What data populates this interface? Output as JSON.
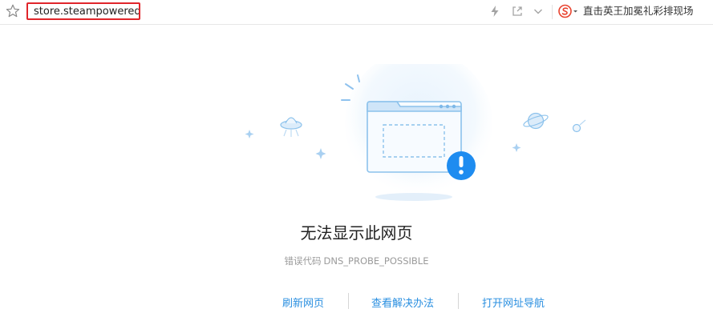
{
  "address_bar": {
    "url": "store.steampowered"
  },
  "toolbar": {
    "promo_text": "直击英王加冕礼彩排现场"
  },
  "error_page": {
    "title": "无法显示此网页",
    "code_label": "错误代码",
    "code_value": "DNS_PROBE_POSSIBLE",
    "actions": [
      {
        "label": "刷新网页"
      },
      {
        "label": "查看解决办法"
      },
      {
        "label": "打开网址导航"
      }
    ]
  },
  "colors": {
    "address_highlight": "#e0252b",
    "link": "#2a8fe0",
    "alert": "#1e8cf0"
  }
}
